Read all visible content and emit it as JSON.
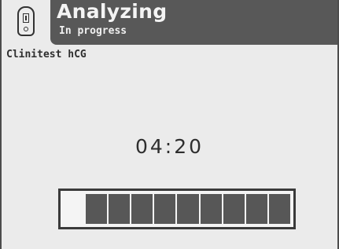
{
  "header": {
    "title": "Analyzing",
    "subtitle": "In progress",
    "icon": "test-cassette-icon"
  },
  "test": {
    "name": "Clinitest hCG"
  },
  "timer": {
    "remaining": "04:20"
  },
  "progress": {
    "segments_total": 9,
    "segments_filled": 9
  },
  "colors": {
    "header_background": "#585858",
    "screen_background": "#ebebeb",
    "segment_fill": "#575757",
    "text_dark": "#2e2e2e",
    "text_light": "#f4f4f4"
  }
}
